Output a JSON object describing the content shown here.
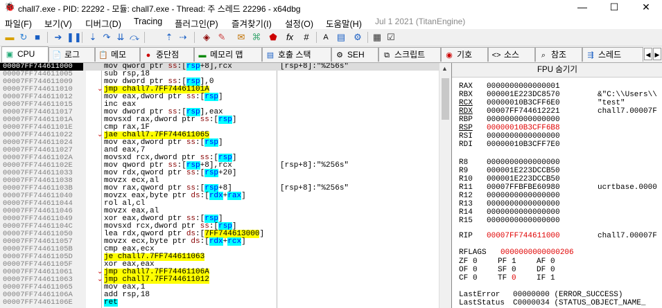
{
  "window": {
    "title": "chall7.exe - PID: 22292 - 모듈: chall7.exe - Thread: 주 스레드 22296 - x64dbg",
    "minimize": "—",
    "maximize": "☐",
    "close": "✕"
  },
  "menu": {
    "items": [
      "파일(F)",
      "보기(V)",
      "디버그(D)",
      "Tracing",
      "플러그인(P)",
      "즐겨찾기(I)",
      "설정(O)",
      "도움말(H)"
    ],
    "version": "Jul 1 2021 (TitanEngine)"
  },
  "tabs": [
    "CPU",
    "로그",
    "메모",
    "중단점",
    "메모리 맵",
    "호출 스택",
    "SEH",
    "스크립트",
    "기호",
    "소스",
    "참조",
    "스레드"
  ],
  "disasm": {
    "rows": [
      {
        "addr": "00007FF744611000",
        "ins": "mov qword ptr ss:[rsp+8],rcx",
        "cmt": "[rsp+8]:\"%256s\""
      },
      {
        "addr": "00007FF744611005",
        "ins": "sub rsp,18",
        "cmt": ""
      },
      {
        "addr": "00007FF744611009",
        "ins": "mov dword ptr ss:[rsp],0",
        "cmt": ""
      },
      {
        "addr": "00007FF744611010",
        "ins": "jmp chall7.7FF74461101A",
        "cmt": ""
      },
      {
        "addr": "00007FF744611012",
        "ins": "mov eax,dword ptr ss:[rsp]",
        "cmt": ""
      },
      {
        "addr": "00007FF744611015",
        "ins": "inc eax",
        "cmt": ""
      },
      {
        "addr": "00007FF744611017",
        "ins": "mov dword ptr ss:[rsp],eax",
        "cmt": ""
      },
      {
        "addr": "00007FF74461101A",
        "ins": "movsxd rax,dword ptr ss:[rsp]",
        "cmt": ""
      },
      {
        "addr": "00007FF74461101E",
        "ins": "cmp rax,1F",
        "cmt": ""
      },
      {
        "addr": "00007FF744611022",
        "ins": "jae chall7.7FF744611065",
        "cmt": ""
      },
      {
        "addr": "00007FF744611024",
        "ins": "mov eax,dword ptr ss:[rsp]",
        "cmt": ""
      },
      {
        "addr": "00007FF744611027",
        "ins": "and eax,7",
        "cmt": ""
      },
      {
        "addr": "00007FF74461102A",
        "ins": "movsxd rcx,dword ptr ss:[rsp]",
        "cmt": ""
      },
      {
        "addr": "00007FF74461102E",
        "ins": "mov qword ptr ss:[rsp+8],rcx",
        "cmt": "[rsp+8]:\"%256s\""
      },
      {
        "addr": "00007FF744611033",
        "ins": "mov rdx,qword ptr ss:[rsp+20]",
        "cmt": ""
      },
      {
        "addr": "00007FF744611038",
        "ins": "movzx ecx,al",
        "cmt": ""
      },
      {
        "addr": "00007FF74461103B",
        "ins": "mov rax,qword ptr ss:[rsp+8]",
        "cmt": "[rsp+8]:\"%256s\""
      },
      {
        "addr": "00007FF744611040",
        "ins": "movzx eax,byte ptr ds:[rdx+rax]",
        "cmt": ""
      },
      {
        "addr": "00007FF744611044",
        "ins": "rol al,cl",
        "cmt": ""
      },
      {
        "addr": "00007FF744611046",
        "ins": "movzx eax,al",
        "cmt": ""
      },
      {
        "addr": "00007FF744611049",
        "ins": "xor eax,dword ptr ss:[rsp]",
        "cmt": ""
      },
      {
        "addr": "00007FF74461104C",
        "ins": "movsxd rcx,dword ptr ss:[rsp]",
        "cmt": ""
      },
      {
        "addr": "00007FF744611050",
        "ins": "lea rdx,qword ptr ds:[7FF744613000]",
        "cmt": ""
      },
      {
        "addr": "00007FF744611057",
        "ins": "movzx ecx,byte ptr ds:[rdx+rcx]",
        "cmt": ""
      },
      {
        "addr": "00007FF74461105B",
        "ins": "cmp eax,ecx",
        "cmt": ""
      },
      {
        "addr": "00007FF74461105D",
        "ins": "je chall7.7FF744611063",
        "cmt": ""
      },
      {
        "addr": "00007FF74461105F",
        "ins": "xor eax,eax",
        "cmt": ""
      },
      {
        "addr": "00007FF744611061",
        "ins": "jmp chall7.7FF74461106A",
        "cmt": ""
      },
      {
        "addr": "00007FF744611063",
        "ins": "jmp chall7.7FF744611012",
        "cmt": ""
      },
      {
        "addr": "00007FF744611065",
        "ins": "mov eax,1",
        "cmt": ""
      },
      {
        "addr": "00007FF74461106A",
        "ins": "add rsp,18",
        "cmt": ""
      },
      {
        "addr": "00007FF74461106E",
        "ins": "ret",
        "cmt": ""
      }
    ]
  },
  "registers": {
    "header": "FPU 숨기기",
    "gp1": [
      {
        "name": "RAX",
        "value": "0000000000000001",
        "comment": ""
      },
      {
        "name": "RBX",
        "value": "000001E223DC8570",
        "comment": "&\"C:\\\\Users\\\\"
      },
      {
        "name": "RCX",
        "value": "00000010B3CFF6E0",
        "comment": "\"test\""
      },
      {
        "name": "RDX",
        "value": "00007FF744612221",
        "comment": "chall7.00007F"
      },
      {
        "name": "RBP",
        "value": "0000000000000000",
        "comment": ""
      },
      {
        "name": "RSP",
        "value": "00000010B3CFF6B8",
        "comment": ""
      },
      {
        "name": "RSI",
        "value": "0000000000000000",
        "comment": ""
      },
      {
        "name": "RDI",
        "value": "00000010B3CFF7E0",
        "comment": ""
      }
    ],
    "gp2": [
      {
        "name": "R8",
        "value": "0000000000000000",
        "comment": ""
      },
      {
        "name": "R9",
        "value": "000001E223DCCB50",
        "comment": ""
      },
      {
        "name": "R10",
        "value": "000001E223DCCB50",
        "comment": ""
      },
      {
        "name": "R11",
        "value": "00007FFBFBE60980",
        "comment": "ucrtbase.0000"
      },
      {
        "name": "R12",
        "value": "0000000000000000",
        "comment": ""
      },
      {
        "name": "R13",
        "value": "0000000000000000",
        "comment": ""
      },
      {
        "name": "R14",
        "value": "0000000000000000",
        "comment": ""
      },
      {
        "name": "R15",
        "value": "0000000000000000",
        "comment": ""
      }
    ],
    "rip": {
      "name": "RIP",
      "value": "00007FF744611000",
      "comment": "chall7.00007F"
    },
    "rflags": {
      "name": "RFLAGS",
      "value": "0000000000000206"
    },
    "flags": [
      [
        {
          "n": "ZF",
          "v": "0"
        },
        {
          "n": "PF",
          "v": "1"
        },
        {
          "n": "AF",
          "v": "0"
        }
      ],
      [
        {
          "n": "OF",
          "v": "0"
        },
        {
          "n": "SF",
          "v": "0"
        },
        {
          "n": "DF",
          "v": "0"
        }
      ],
      [
        {
          "n": "CF",
          "v": "0"
        },
        {
          "n": "TF",
          "v": "0"
        },
        {
          "n": "IF",
          "v": "1"
        }
      ]
    ],
    "last_error": {
      "label": "LastError",
      "value": "00000000 (ERROR_SUCCESS)"
    },
    "last_status": {
      "label": "LastStatus",
      "value": "C0000034 (STATUS_OBJECT_NAME_"
    }
  }
}
